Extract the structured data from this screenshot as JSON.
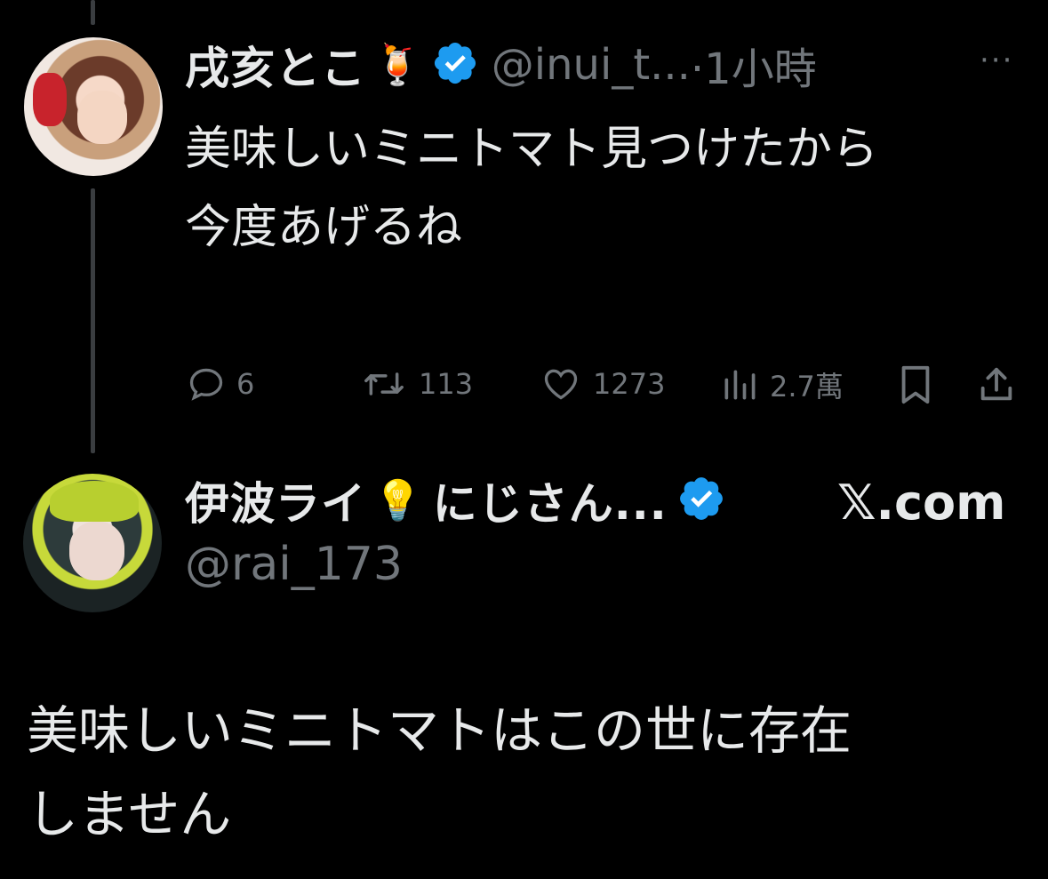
{
  "reply_tweet": {
    "display_name": "戌亥とこ",
    "name_emoji": "🍹",
    "handle": "@inui_t...",
    "time": "·1小時",
    "more_label": "···",
    "text": "美味しいミニトマト見つけたから\n今度あげるね",
    "actions": {
      "replies": "6",
      "retweets": "113",
      "likes": "1273",
      "views": "2.7萬"
    },
    "icons": [
      "reply-icon",
      "retweet-icon",
      "like-icon",
      "views-icon",
      "bookmark-icon",
      "share-icon"
    ]
  },
  "quoted_tweet": {
    "display_name": "伊波ライ",
    "name_emoji": "💡",
    "name_suffix": "にじさん...",
    "source": "𝕏.com",
    "handle": "@rai_173",
    "text": "美味しいミニトマトはこの世に存在\nしません"
  },
  "colors": {
    "background": "#000000",
    "text": "#e7e9ea",
    "muted": "#71767b",
    "verified": "#1d9bf0",
    "thread_line": "#3a3d40"
  }
}
